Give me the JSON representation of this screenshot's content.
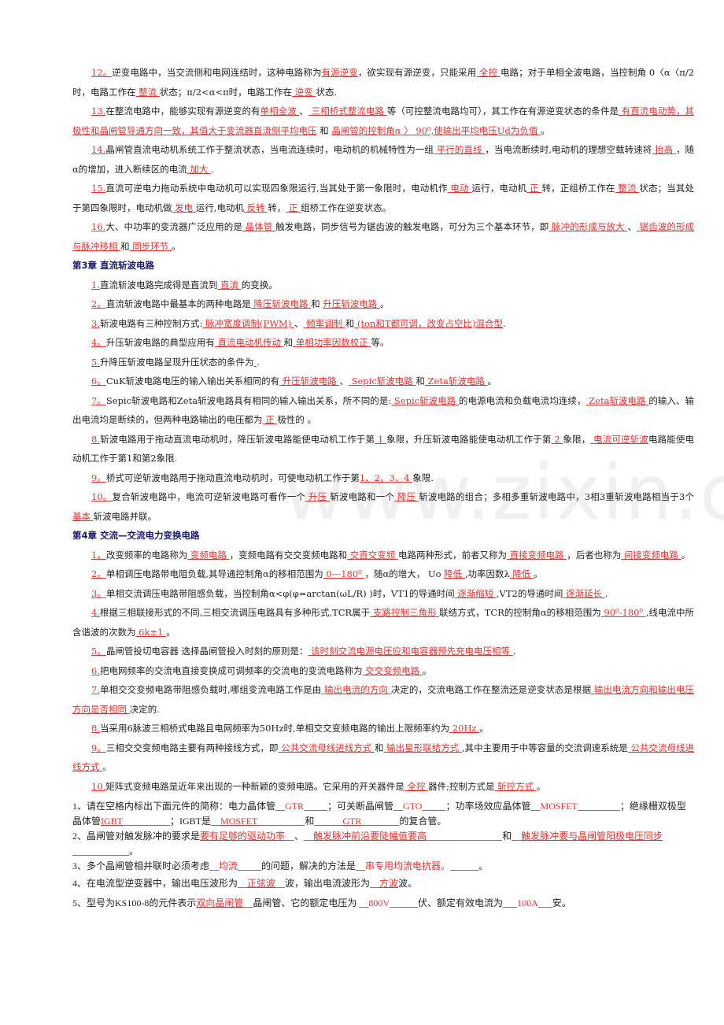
{
  "watermark": "www.zixin.com.cn",
  "colors": {
    "answer": "#e8302f",
    "heading": "#1a1a6e",
    "text": "#222222"
  },
  "section_prev": [
    {
      "num": "12。",
      "parts": [
        {
          "t": "逆变电路中，当交流侧和电网连结时，这种电路称为"
        },
        {
          "a": "有源逆变"
        },
        {
          "t": "，欲实现有源逆变，只能采用"
        },
        {
          "a": "  全控 "
        },
        {
          "t": "电路；对于单相全波电路，当控制角 0〈α〈π/2时，电路工作在"
        },
        {
          "a": "  整流 "
        },
        {
          "t": "状态；π/2<α<π时，电路工作在"
        },
        {
          "a": "  逆变 "
        },
        {
          "t": "状态."
        }
      ]
    },
    {
      "num": "13.",
      "parts": [
        {
          "t": "在整流电路中，能够实现有源逆变的有"
        },
        {
          "a": "单相全波 "
        },
        {
          "t": "、"
        },
        {
          "a": " 三相桥式整流电路 "
        },
        {
          "t": "等（可控整流电路均可），其工作在有源逆变状态的条件是"
        },
        {
          "a": " 有直流电动势，其极性和晶闸管导通方向一致，其值大于变流器直流侧平均电压"
        },
        {
          "t": " 和 "
        },
        {
          "a": "  晶闸管的控制角α 〉 90⁰,使输出平均电压Ud为负值 "
        },
        {
          "t": "。"
        }
      ]
    },
    {
      "num": "14.",
      "parts": [
        {
          "t": "晶闸管直流电动机系统工作于整流状态，当电流连续时，电动机的机械特性为一组"
        },
        {
          "a": " 平行的直线 "
        },
        {
          "t": "，当电流断续时,电动机的理想空载转速将"
        },
        {
          "a": " 抬高 "
        },
        {
          "t": "，随α的增加，进入断续区的电流"
        },
        {
          "a": " 加大 "
        },
        {
          "t": "."
        }
      ]
    },
    {
      "num": "15.",
      "parts": [
        {
          "t": "直流可逆电力拖动系统中电动机可以实现四象限运行,当其处于第一象限时，电动机作"
        },
        {
          "a": " 电动  "
        },
        {
          "t": "运行，电动机"
        },
        {
          "a": " 正  "
        },
        {
          "t": "转，正组桥工作在"
        },
        {
          "a": " 整流 "
        },
        {
          "t": "状态；当其处于第四象限时，电动机做"
        },
        {
          "a": " 发电 "
        },
        {
          "t": "运行,电动机"
        },
        {
          "a": " 反转 "
        },
        {
          "t": "转，"
        },
        {
          "a": "    正 "
        },
        {
          "t": "组桥工作在逆变状态。"
        }
      ]
    },
    {
      "num": "16.",
      "parts": [
        {
          "t": "大、中功率的变流器广泛应用的是"
        },
        {
          "a": " 晶体管  "
        },
        {
          "t": "触发电路，同步信号为锯齿波的触发电路，可分为三个基本环节，即"
        },
        {
          "a": " 脉冲的形成与放大  "
        },
        {
          "t": "、"
        },
        {
          "a": " 锯齿波的形成与脉冲移相 "
        },
        {
          "t": "和"
        },
        {
          "a": " 同步环节 "
        },
        {
          "t": "。"
        }
      ]
    }
  ],
  "chapter3": {
    "title": "第3章  直流斩波电路",
    "items": [
      {
        "num": "1.",
        "parts": [
          {
            "t": "直流斩波电路完成得是直流到"
          },
          {
            "a": " 直流 "
          },
          {
            "t": "的变换。"
          }
        ]
      },
      {
        "num": "2。",
        "parts": [
          {
            "t": "直流斩波电路中最基本的两种电路是"
          },
          {
            "a": " 降压斩波电路 "
          },
          {
            "t": " 和 "
          },
          {
            "a": " 升压斩波电路 "
          },
          {
            "t": "。"
          }
        ]
      },
      {
        "num": "3.",
        "parts": [
          {
            "t": "斩波电路有三种控制方式:"
          },
          {
            "a": " 脉冲宽度调制(PWM)  "
          },
          {
            "t": "、"
          },
          {
            "a": " 频率调制 "
          },
          {
            "t": "和"
          },
          {
            "a": " (ton和T都可调，改变占空比)混合型"
          },
          {
            "t": "."
          }
        ]
      },
      {
        "num": "4。",
        "parts": [
          {
            "t": "升压斩波电路的典型应用有"
          },
          {
            "a": " 直流电动机传动 "
          },
          {
            "t": "和"
          },
          {
            "a": " 单相功率因数校正 "
          },
          {
            "t": "等。"
          }
        ]
      },
      {
        "num": "5.",
        "parts": [
          {
            "t": "升降压斩波电路呈现升压状态的条件为"
          },
          {
            "a": "        "
          },
          {
            "t": "."
          }
        ]
      },
      {
        "num": "6。",
        "parts": [
          {
            "t": "CuK斩波电路电压的输入输出关系相同的有"
          },
          {
            "a": "  升压斩波电路    "
          },
          {
            "t": "、"
          },
          {
            "a": "  Sepic斩波电路 "
          },
          {
            "t": "和"
          },
          {
            "a": "  Zeta斩波电路   "
          },
          {
            "t": "。"
          }
        ]
      },
      {
        "num": "7。",
        "parts": [
          {
            "t": "Sepic斩波电路和Zeta斩波电路具有相同的输入输出关系，所不同的是:"
          },
          {
            "a": "  Sepic斩波电路 "
          },
          {
            "t": "的电源电流和负载电流均连续，"
          },
          {
            "a": "  Zeta斩波电路 "
          },
          {
            "t": "的输入、输出电流均是断续的，但两种电路输出的电压都为"
          },
          {
            "a": "  正  "
          },
          {
            "t": "极性的 。"
          }
        ]
      },
      {
        "num": "8.",
        "parts": [
          {
            "t": "斩波电路用于拖动直流电动机时，降压斩波电路能使电动机工作于第"
          },
          {
            "a": "  1   "
          },
          {
            "t": "象限，升压斩波电路能使电动机工作于第"
          },
          {
            "a": "  2   "
          },
          {
            "t": "象限，"
          },
          {
            "a": " 电流可逆斩波"
          },
          {
            "t": "电路能使电动机工作于第1和第2象限."
          }
        ]
      },
      {
        "num": "9。",
        "parts": [
          {
            "t": "桥式可逆斩波电路用于拖动直流电动机时，可使电动机工作于第"
          },
          {
            "a": "1、2、3、4 "
          },
          {
            "t": "象限."
          }
        ]
      },
      {
        "num": "10。",
        "parts": [
          {
            "t": "复合斩波电路中，电流可逆斩波电路可看作一个"
          },
          {
            "a": " 升压 "
          },
          {
            "t": "斩波电路和一个"
          },
          {
            "a": "  降压 "
          },
          {
            "t": "斩波电路的组合；多相多重斩波电路中，3相3重斩波电路相当于3个"
          },
          {
            "a": "  基本   "
          },
          {
            "t": "斩波电路并联。"
          }
        ]
      }
    ]
  },
  "chapter4": {
    "title": "第4章  交流—交流电力变换电路",
    "items": [
      {
        "num": "1。",
        "parts": [
          {
            "t": "改变频率的电路称为"
          },
          {
            "a": " 变频电路 "
          },
          {
            "t": "，变频电路有交交变频电路和"
          },
          {
            "a": " 交直交变频 "
          },
          {
            "t": "电路两种形式，前者又称为"
          },
          {
            "a": " 直接变频电路   "
          },
          {
            "t": "，后者也称为"
          },
          {
            "a": " 间接变频电路 "
          },
          {
            "t": "。"
          }
        ]
      },
      {
        "num": "2。",
        "parts": [
          {
            "t": "单相调压电路带电阻负载,其导通控制角α的移相范围为"
          },
          {
            "a": " 0—180⁰ "
          },
          {
            "t": "，随α的增大，  Uo "
          },
          {
            "a": " 降低 "
          },
          {
            "t": ",功率因数λ"
          },
          {
            "a": " 降低   "
          },
          {
            "t": "。"
          }
        ]
      },
      {
        "num": "3。",
        "parts": [
          {
            "t": "单相交流调压电路带阻感负载，当控制角α<φ(φ=arctan(ωL/R) )时，VT1的导通时间"
          },
          {
            "a": " 逐渐缩短 "
          },
          {
            "t": ",VT2的导通时间"
          },
          {
            "a": "  逐渐延长 "
          },
          {
            "t": "."
          }
        ]
      },
      {
        "num": "4.",
        "parts": [
          {
            "t": "根据三相联接形式的不同,三相交流调压电路具有多种形式,TCR属于"
          },
          {
            "a": " 支路控制三角形 "
          },
          {
            "t": "联结方式，TCR的控制角α的移相范围为"
          },
          {
            "a": " 90⁰-180⁰ "
          },
          {
            "t": ",线电流中所含谐波的次数为"
          },
          {
            "a": " 6k±1  "
          },
          {
            "t": "。"
          }
        ]
      },
      {
        "num": "5。",
        "parts": [
          {
            "t": "晶闸管投切电容器 选择晶闸管投入时刻的原则是："
          },
          {
            "a": "  该时刻交流电源电压应和电容器预先充电电压相等 "
          },
          {
            "t": "."
          }
        ]
      },
      {
        "num": "6.",
        "parts": [
          {
            "t": "把电网频率的交流电直接变换成可调频率的交流电的变流电路称为"
          },
          {
            "a": "   交交变频电路  "
          },
          {
            "t": "。"
          }
        ]
      },
      {
        "num": "7.",
        "parts": [
          {
            "t": "单相交交变频电路带阻感负载时,哪组变流电路工作是由"
          },
          {
            "a": " 输出电流的方向 "
          },
          {
            "t": "决定的，交流电路工作在整流还是逆变状态是根据"
          },
          {
            "a": " 输出电流方向和输出电压方向是否相同 "
          },
          {
            "t": "决定的."
          }
        ]
      },
      {
        "num": "8.",
        "parts": [
          {
            "t": "当采用6脉波三相桥式电路且电网频率为50Hz时,单相交交变频电路的输出上限频率约为"
          },
          {
            "a": " 20Hz   "
          },
          {
            "t": "。"
          }
        ]
      },
      {
        "num": "9。",
        "parts": [
          {
            "t": "三相交交变频电路主要有两种接线方式，即"
          },
          {
            "a": " 公共交流母线进线方式 "
          },
          {
            "t": "和"
          },
          {
            "a": " 输出星形联结方式 "
          },
          {
            "t": ",其中主要用于中等容量的交流调速系统是"
          },
          {
            "a": " 公共交流母线进线方式 "
          },
          {
            "t": "。"
          }
        ]
      },
      {
        "num": "10.",
        "parts": [
          {
            "t": "矩阵式变频电路是近年来出现的一种新颖的变频电路。它采用的开关器件是"
          },
          {
            "a": " 全控 "
          },
          {
            "t": "器件;控制方式是"
          },
          {
            "a": " 斩控方式   "
          },
          {
            "t": "。"
          }
        ]
      }
    ]
  },
  "questions": [
    {
      "parts": [
        {
          "t": "1、请在空格内标出下面元件的简称：电力晶体管__"
        },
        {
          "r": "GTR"
        },
        {
          "t": "_____；可关断晶闸管__"
        },
        {
          "r": "GTO"
        },
        {
          "t": "_____；功率场效应晶体管__"
        },
        {
          "r": "MOSFET"
        },
        {
          "t": "_________；绝缘栅双极型晶体管"
        },
        {
          "a": "IGBT"
        },
        {
          "t": "__________；IGBT是__"
        },
        {
          "a": "MOSFET"
        },
        {
          "t": "__________和______"
        },
        {
          "a": "GTR"
        },
        {
          "t": "________的复合管。"
        }
      ]
    },
    {
      "parts": [
        {
          "t": "2、晶闸管对触发脉冲的要求是"
        },
        {
          "a": "要有足够的驱动功率"
        },
        {
          "t": "__、__"
        },
        {
          "a": "触发脉冲前沿要陡幅值要高"
        },
        {
          "t": "________________和__"
        },
        {
          "a": "触发脉冲要与晶闸管阳极电压同步"
        },
        {
          "t": "____________。"
        }
      ]
    },
    {
      "parts": [
        {
          "t": "3、多个晶闸管相并联时必须考虑__"
        },
        {
          "r": "均流"
        },
        {
          "t": "_____的问题，解决的方法是__"
        },
        {
          "r": "串专用均流电抗器。"
        },
        {
          "t": "______。"
        }
      ]
    },
    {
      "parts": [
        {
          "t": "4、在电流型逆变器中，输出电压波形为__"
        },
        {
          "a": "正弦波"
        },
        {
          "t": "__波，输出电流波形为__"
        },
        {
          "a": "方波"
        },
        {
          "t": "波。"
        }
      ]
    },
    {
      "parts": [
        {
          "t": "5、型号为KS100-8的元件表示"
        },
        {
          "a": "双向晶闸管"
        },
        {
          "t": "__晶闸管、它的额定电压为 __"
        },
        {
          "r": "800V"
        },
        {
          "t": "______伏、额定有效电流为___"
        },
        {
          "r": "100A"
        },
        {
          "t": "___安。"
        }
      ]
    }
  ]
}
